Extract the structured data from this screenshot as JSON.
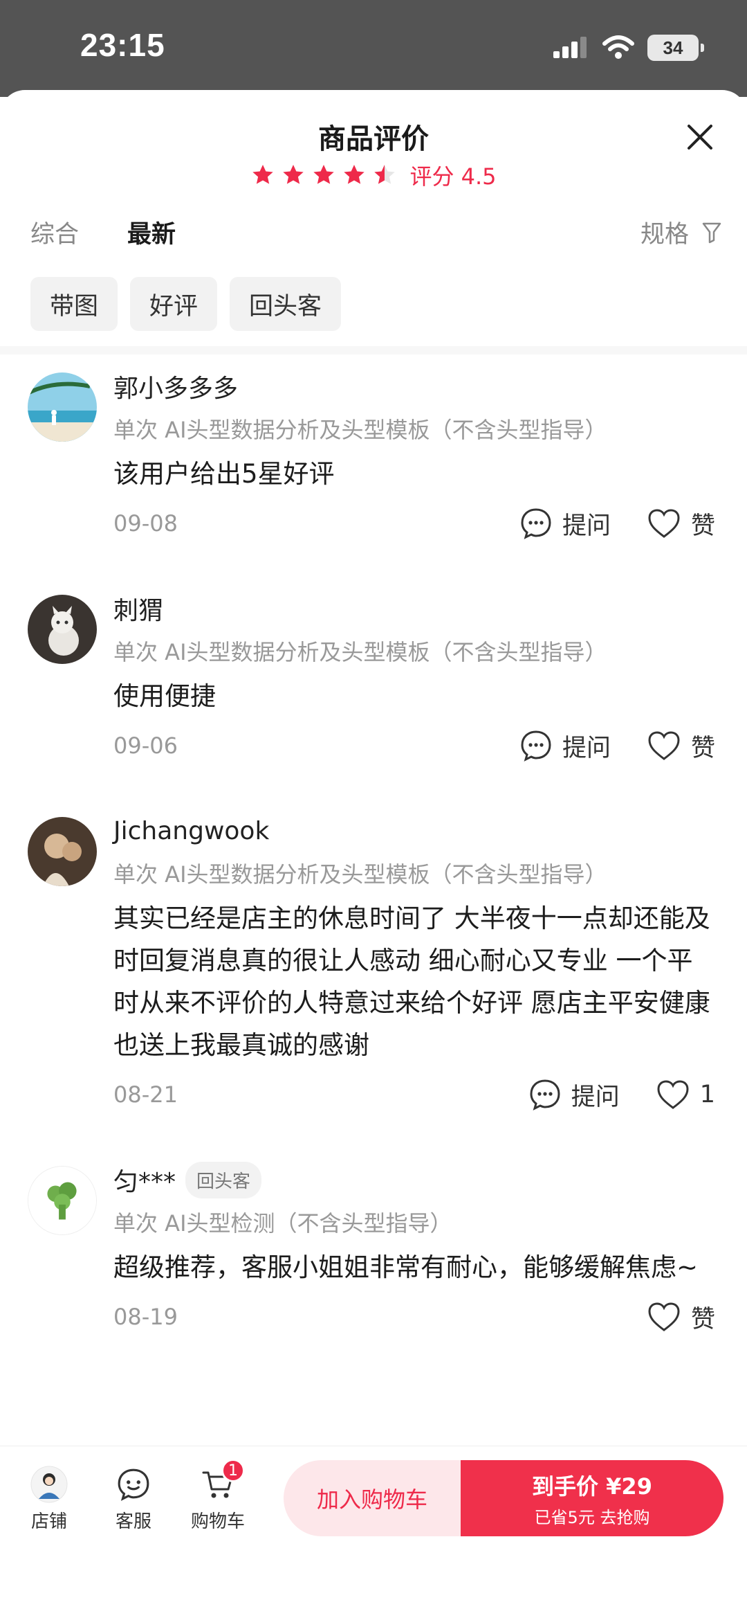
{
  "status": {
    "time": "23:15",
    "battery": "34"
  },
  "header": {
    "title": "商品评价",
    "rating_text": "评分 4.5",
    "rating": 4.5,
    "star_color": "#ee2a4a"
  },
  "sort_tabs": [
    {
      "label": "综合",
      "active": false
    },
    {
      "label": "最新",
      "active": true
    }
  ],
  "spec_filter": {
    "label": "规格"
  },
  "chips": [
    "带图",
    "好评",
    "回头客"
  ],
  "reviews": [
    {
      "username": "郭小多多多",
      "badge": "",
      "sku": "单次 AI头型数据分析及头型模板（不含头型指导）",
      "content": "该用户给出5星好评",
      "date": "09-08",
      "ask_label": "提问",
      "like_label": "赞"
    },
    {
      "username": "刺猬",
      "badge": "",
      "sku": "单次 AI头型数据分析及头型模板（不含头型指导）",
      "content": "使用便捷",
      "date": "09-06",
      "ask_label": "提问",
      "like_label": "赞"
    },
    {
      "username": "Jichangwook",
      "badge": "",
      "sku": "单次 AI头型数据分析及头型模板（不含头型指导）",
      "content": "其实已经是店主的休息时间了 大半夜十一点却还能及时回复消息真的很让人感动 细心耐心又专业 一个平时从来不评价的人特意过来给个好评 愿店主平安健康 也送上我最真诚的感谢",
      "date": "08-21",
      "ask_label": "提问",
      "like_label": "1"
    },
    {
      "username": "匀***",
      "badge": "回头客",
      "sku": "单次 AI头型检测（不含头型指导）",
      "content": "超级推荐，客服小姐姐非常有耐心，能够缓解焦虑~",
      "date": "08-19",
      "ask_label": "",
      "like_label": "赞"
    }
  ],
  "bottom_bar": {
    "shop_label": "店铺",
    "service_label": "客服",
    "cart_label": "购物车",
    "cart_count": "1",
    "add_cart_label": "加入购物车",
    "buy_label": "到手价 ¥29",
    "buy_sub": "已省5元 去抢购"
  }
}
